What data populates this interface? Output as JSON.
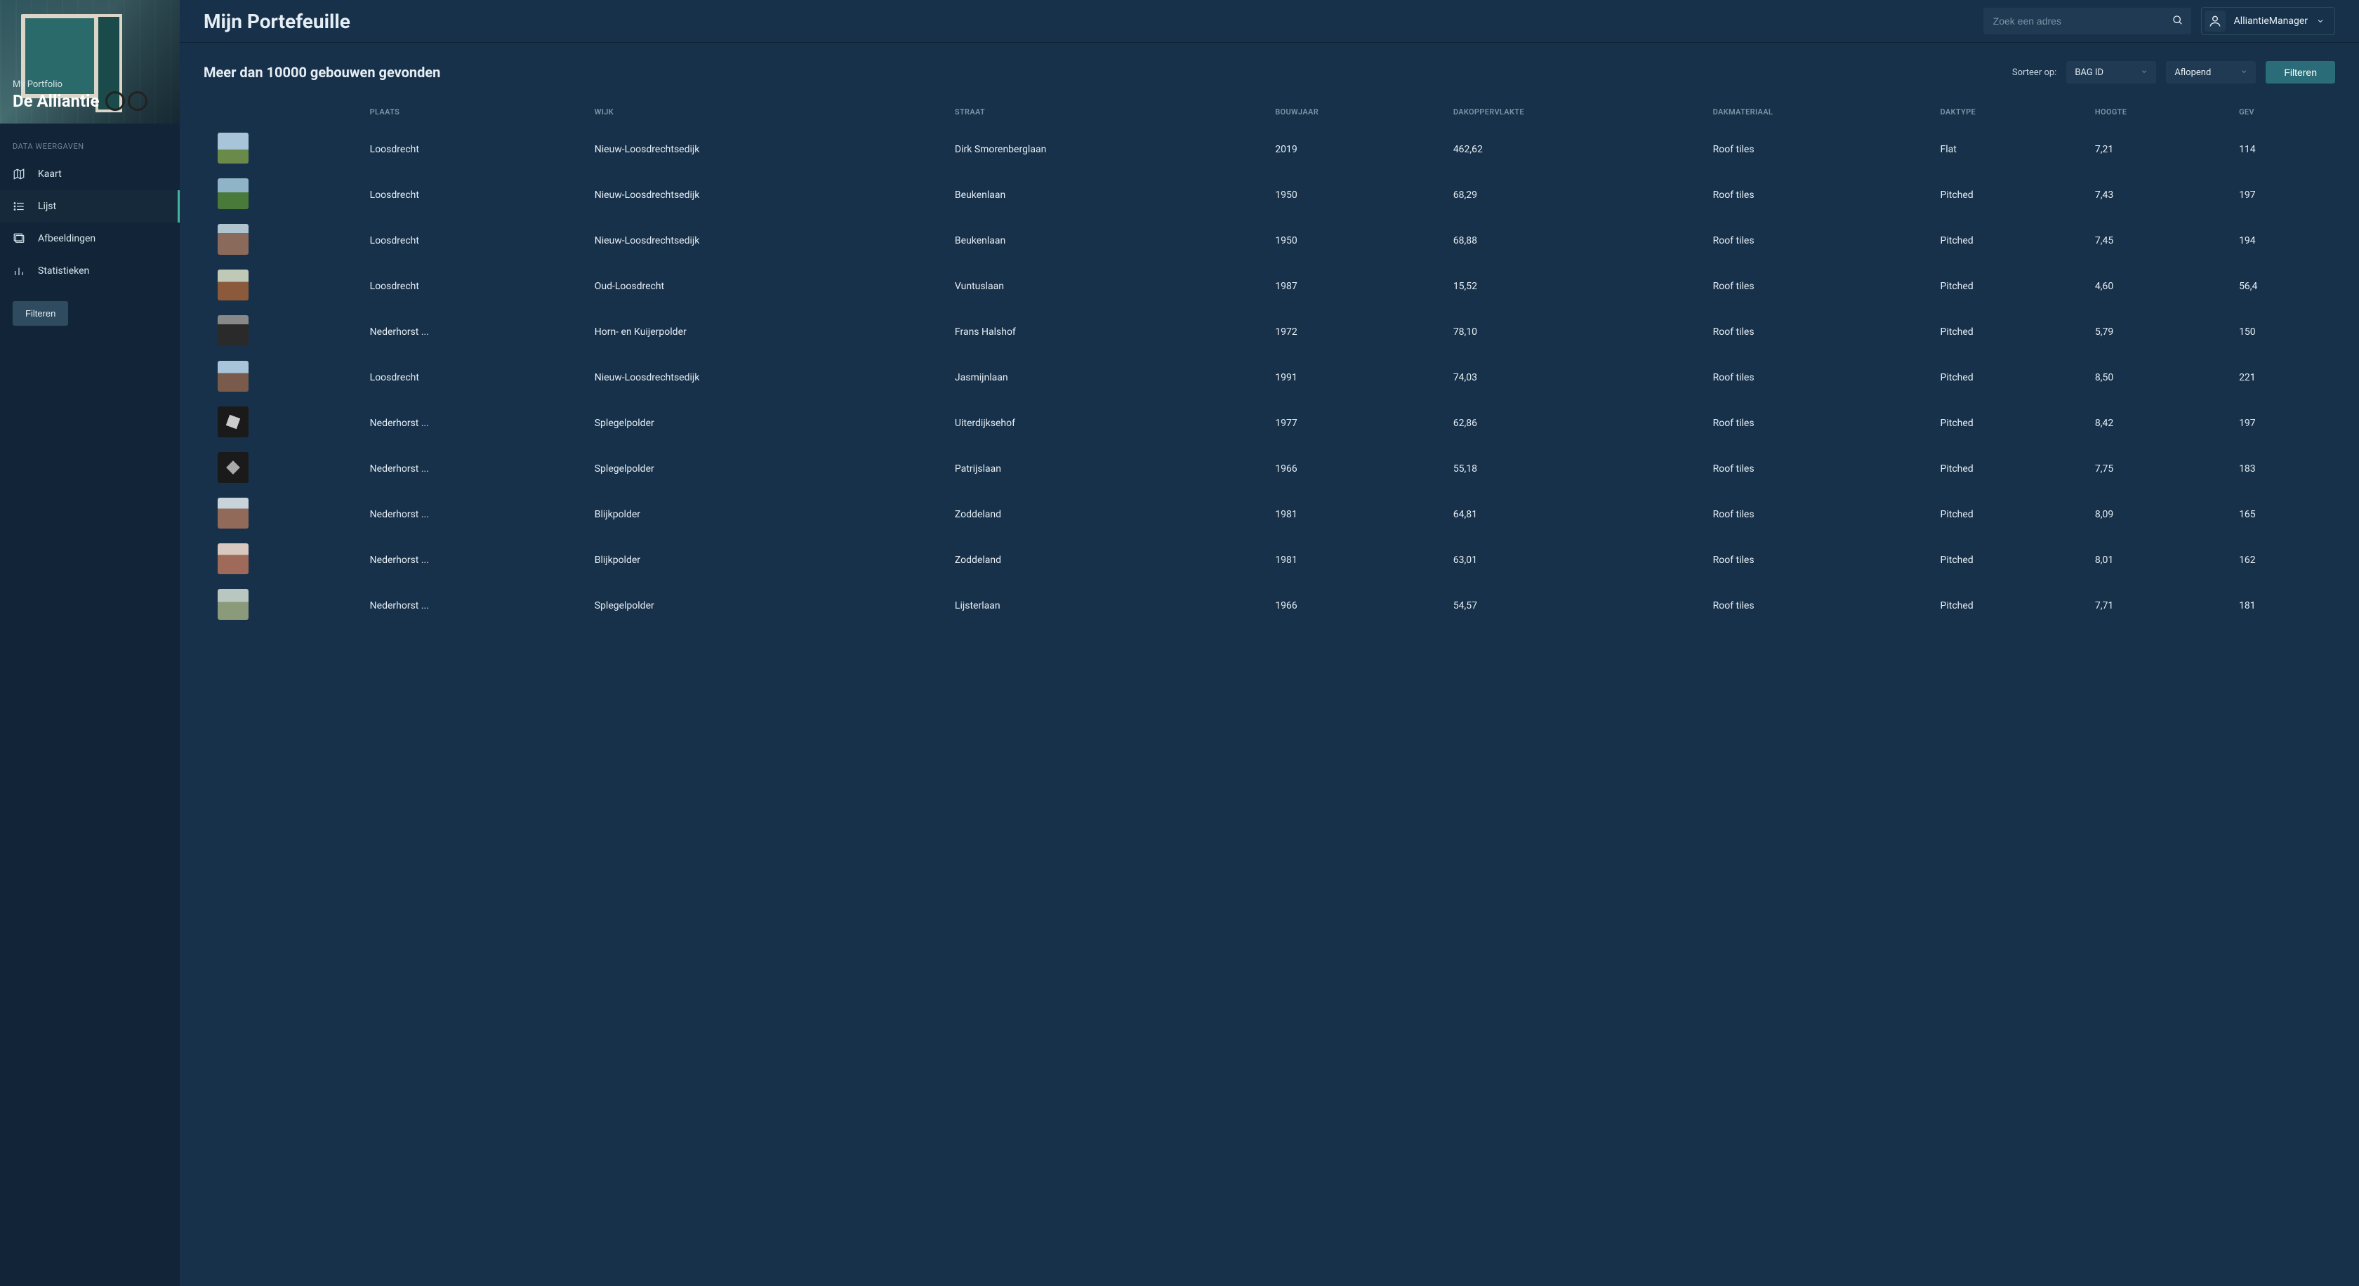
{
  "sidebar": {
    "hero_sub": "My Portfolio",
    "hero_main": "De Alliantie",
    "section_label": "DATA WEERGAVEN",
    "nav": [
      {
        "label": "Kaart",
        "icon": "map-icon"
      },
      {
        "label": "Lijst",
        "icon": "list-icon"
      },
      {
        "label": "Afbeeldingen",
        "icon": "images-icon"
      },
      {
        "label": "Statistieken",
        "icon": "stats-icon"
      }
    ],
    "filter_label": "Filteren",
    "active_index": 1
  },
  "topbar": {
    "title": "Mijn Portefeuille",
    "search_placeholder": "Zoek een adres",
    "user_name": "AlliantieManager"
  },
  "controls": {
    "results_title": "Meer dan 10000 gebouwen gevonden",
    "sort_label": "Sorteer op:",
    "sort_field": "BAG ID",
    "sort_dir": "Aflopend",
    "filter_label": "Filteren"
  },
  "table": {
    "columns": [
      "PLAATS",
      "WIJK",
      "STRAAT",
      "BOUWJAAR",
      "DAKOPPERVLAKTE",
      "DAKMATERIAAL",
      "DAKTYPE",
      "HOOGTE",
      "GEV"
    ],
    "rows": [
      {
        "plaats": "Loosdrecht",
        "wijk": "Nieuw-Loosdrechtsedijk",
        "straat": "Dirk Smorenberglaan",
        "bouwjaar": "2019",
        "dakopp": "462,62",
        "dakmat": "Roof tiles",
        "daktype": "Flat",
        "hoogte": "7,21",
        "gev": "114"
      },
      {
        "plaats": "Loosdrecht",
        "wijk": "Nieuw-Loosdrechtsedijk",
        "straat": "Beukenlaan",
        "bouwjaar": "1950",
        "dakopp": "68,29",
        "dakmat": "Roof tiles",
        "daktype": "Pitched",
        "hoogte": "7,43",
        "gev": "197"
      },
      {
        "plaats": "Loosdrecht",
        "wijk": "Nieuw-Loosdrechtsedijk",
        "straat": "Beukenlaan",
        "bouwjaar": "1950",
        "dakopp": "68,88",
        "dakmat": "Roof tiles",
        "daktype": "Pitched",
        "hoogte": "7,45",
        "gev": "194"
      },
      {
        "plaats": "Loosdrecht",
        "wijk": "Oud-Loosdrecht",
        "straat": "Vuntuslaan",
        "bouwjaar": "1987",
        "dakopp": "15,52",
        "dakmat": "Roof tiles",
        "daktype": "Pitched",
        "hoogte": "4,60",
        "gev": "56,4"
      },
      {
        "plaats": "Nederhorst ...",
        "wijk": "Horn- en Kuijerpolder",
        "straat": "Frans Halshof",
        "bouwjaar": "1972",
        "dakopp": "78,10",
        "dakmat": "Roof tiles",
        "daktype": "Pitched",
        "hoogte": "5,79",
        "gev": "150"
      },
      {
        "plaats": "Loosdrecht",
        "wijk": "Nieuw-Loosdrechtsedijk",
        "straat": "Jasmijnlaan",
        "bouwjaar": "1991",
        "dakopp": "74,03",
        "dakmat": "Roof tiles",
        "daktype": "Pitched",
        "hoogte": "8,50",
        "gev": "221"
      },
      {
        "plaats": "Nederhorst ...",
        "wijk": "Splegelpolder",
        "straat": "Uiterdijksehof",
        "bouwjaar": "1977",
        "dakopp": "62,86",
        "dakmat": "Roof tiles",
        "daktype": "Pitched",
        "hoogte": "8,42",
        "gev": "197"
      },
      {
        "plaats": "Nederhorst ...",
        "wijk": "Splegelpolder",
        "straat": "Patrijslaan",
        "bouwjaar": "1966",
        "dakopp": "55,18",
        "dakmat": "Roof tiles",
        "daktype": "Pitched",
        "hoogte": "7,75",
        "gev": "183"
      },
      {
        "plaats": "Nederhorst ...",
        "wijk": "Blijkpolder",
        "straat": "Zoddeland",
        "bouwjaar": "1981",
        "dakopp": "64,81",
        "dakmat": "Roof tiles",
        "daktype": "Pitched",
        "hoogte": "8,09",
        "gev": "165"
      },
      {
        "plaats": "Nederhorst ...",
        "wijk": "Blijkpolder",
        "straat": "Zoddeland",
        "bouwjaar": "1981",
        "dakopp": "63,01",
        "dakmat": "Roof tiles",
        "daktype": "Pitched",
        "hoogte": "8,01",
        "gev": "162"
      },
      {
        "plaats": "Nederhorst ...",
        "wijk": "Splegelpolder",
        "straat": "Lijsterlaan",
        "bouwjaar": "1966",
        "dakopp": "54,57",
        "dakmat": "Roof tiles",
        "daktype": "Pitched",
        "hoogte": "7,71",
        "gev": "181"
      }
    ]
  }
}
